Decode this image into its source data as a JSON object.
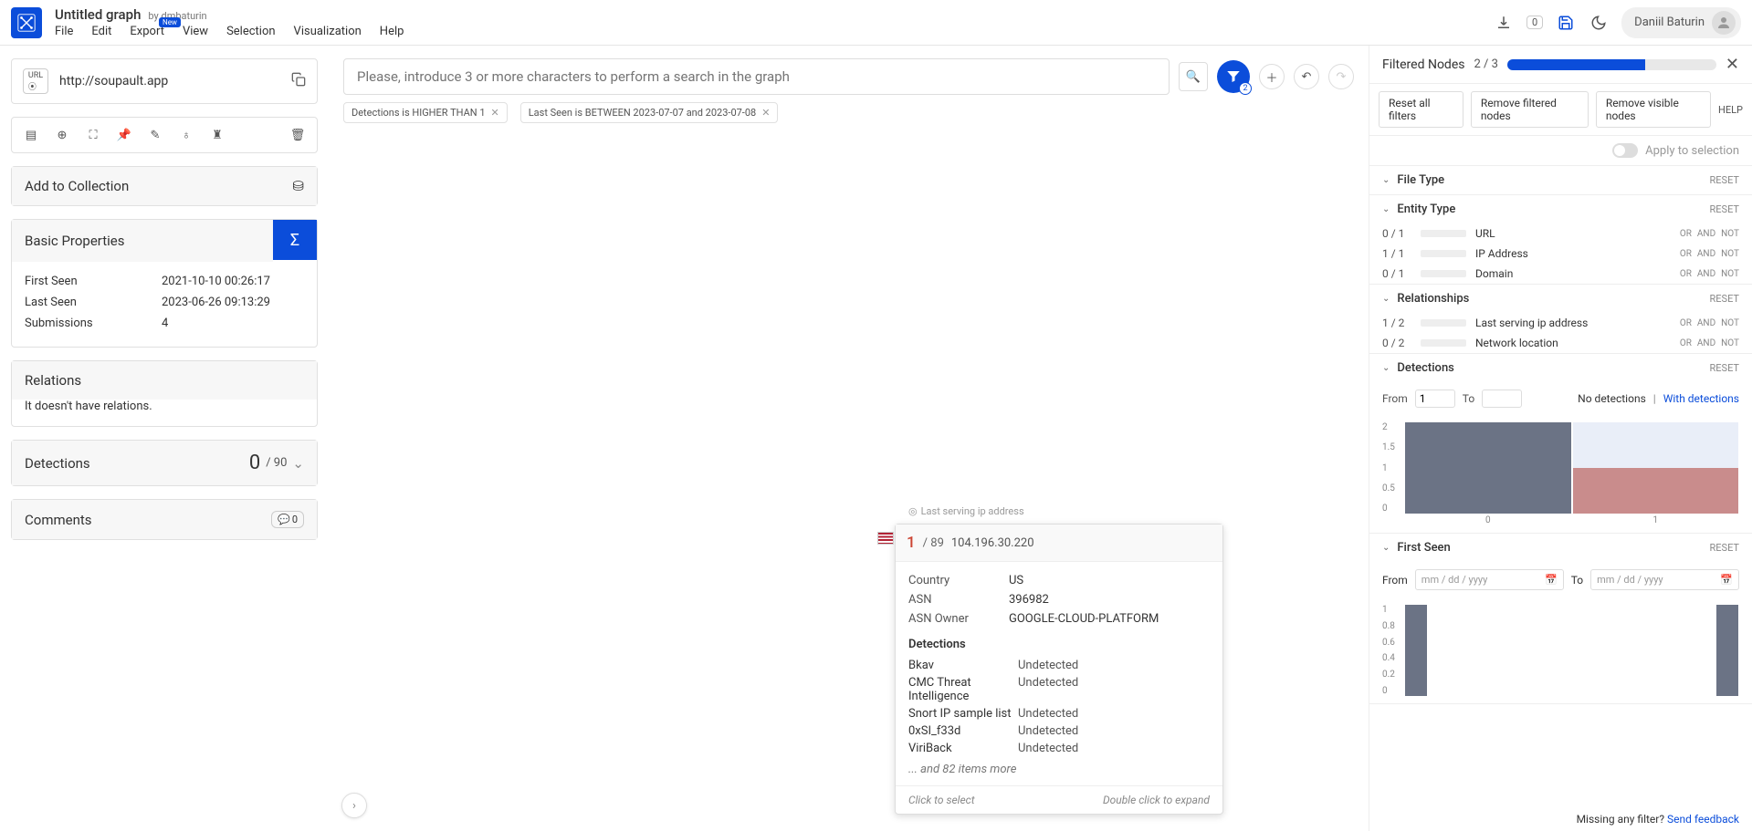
{
  "header": {
    "graph_title": "Untitled graph",
    "by_prefix": "by",
    "by_user": "dmbaturin",
    "menu": [
      "File",
      "Edit",
      "Export",
      "View",
      "Selection",
      "Visualization",
      "Help"
    ],
    "export_badge": "New",
    "notif_count": "0",
    "user_name": "Daniil Baturin"
  },
  "search": {
    "placeholder": "Please, introduce 3 or more characters to perform a search in the graph",
    "filter_count": "2"
  },
  "chips": [
    "Detections is HIGHER THAN 1",
    "Last Seen is BETWEEN 2023-07-07 and 2023-07-08"
  ],
  "left": {
    "url": "http://soupault.app",
    "add_collection": "Add to Collection",
    "basic_properties_title": "Basic Properties",
    "props": [
      {
        "label": "First Seen",
        "value": "2021-10-10 00:26:17"
      },
      {
        "label": "Last Seen",
        "value": "2023-06-26 09:13:29"
      },
      {
        "label": "Submissions",
        "value": "4"
      }
    ],
    "relations_title": "Relations",
    "relations_body": "It doesn't have relations.",
    "detections_title": "Detections",
    "detections_count": "0",
    "detections_total": "/ 90",
    "comments_title": "Comments",
    "comments_count": "0"
  },
  "node": {
    "edge_label": "Last serving ip address",
    "score": "1",
    "total": "/ 89",
    "ip": "104.196.30.220",
    "rows": [
      {
        "label": "Country",
        "value": "US"
      },
      {
        "label": "ASN",
        "value": "396982"
      },
      {
        "label": "ASN Owner",
        "value": "GOOGLE-CLOUD-PLATFORM"
      }
    ],
    "detections_title": "Detections",
    "detections": [
      {
        "name": "Bkav",
        "status": "Undetected"
      },
      {
        "name": "CMC Threat Intelligence",
        "status": "Undetected"
      },
      {
        "name": "Snort IP sample list",
        "status": "Undetected"
      },
      {
        "name": "0xSI_f33d",
        "status": "Undetected"
      },
      {
        "name": "ViriBack",
        "status": "Undetected"
      }
    ],
    "more": "... and 82 items more",
    "footer_left": "Click to select",
    "footer_right": "Double click to expand"
  },
  "right": {
    "title": "Filtered Nodes",
    "frac": "2 / 3",
    "actions": [
      "Reset all filters",
      "Remove filtered nodes",
      "Remove visible nodes"
    ],
    "help": "HELP",
    "apply_label": "Apply to selection",
    "sections": {
      "file_type": {
        "title": "File Type",
        "reset": "RESET"
      },
      "entity_type": {
        "title": "Entity Type",
        "reset": "RESET",
        "rows": [
          {
            "frac": "0 / 1",
            "fill": 0,
            "label": "URL"
          },
          {
            "frac": "1 / 1",
            "fill": 100,
            "label": "IP Address"
          },
          {
            "frac": "0 / 1",
            "fill": 0,
            "label": "Domain"
          }
        ]
      },
      "relationships": {
        "title": "Relationships",
        "reset": "RESET",
        "rows": [
          {
            "frac": "1 / 2",
            "fill": 50,
            "label": "Last serving ip address"
          },
          {
            "frac": "0 / 2",
            "fill": 0,
            "label": "Network location"
          }
        ]
      },
      "detections": {
        "title": "Detections",
        "reset": "RESET",
        "from_label": "From",
        "from_value": "1",
        "to_label": "To",
        "to_value": "",
        "no_det": "No detections",
        "with_det": "With detections"
      },
      "first_seen": {
        "title": "First Seen",
        "reset": "RESET",
        "from_label": "From",
        "to_label": "To",
        "placeholder": "mm / dd / yyyy"
      }
    },
    "ops": [
      "OR",
      "AND",
      "NOT"
    ],
    "feedback_q": "Missing any filter? ",
    "feedback_link": "Send feedback"
  },
  "chart_data": [
    {
      "type": "bar",
      "location": "right_panel.detections_histogram",
      "y_ticks": [
        0,
        0.5,
        1,
        1.5,
        2
      ],
      "x_ticks": [
        "0",
        "1"
      ],
      "series": [
        {
          "name": "background",
          "color": "#e9eef8",
          "values": [
            2,
            2
          ]
        },
        {
          "name": "foreground_grey",
          "color": "#6b7385",
          "values": [
            2,
            0
          ]
        },
        {
          "name": "foreground_red",
          "color": "#c98c8c",
          "values": [
            0,
            1
          ]
        }
      ],
      "ylim": [
        0,
        2
      ]
    },
    {
      "type": "bar",
      "location": "right_panel.first_seen_histogram",
      "y_ticks": [
        0,
        0.2,
        0.4,
        0.6,
        0.8,
        1
      ],
      "x_ticks": [],
      "values": [
        1,
        0,
        0,
        0,
        0,
        0,
        0,
        0,
        0,
        1
      ],
      "color": "#6b7385",
      "ylim": [
        0,
        1
      ]
    }
  ]
}
